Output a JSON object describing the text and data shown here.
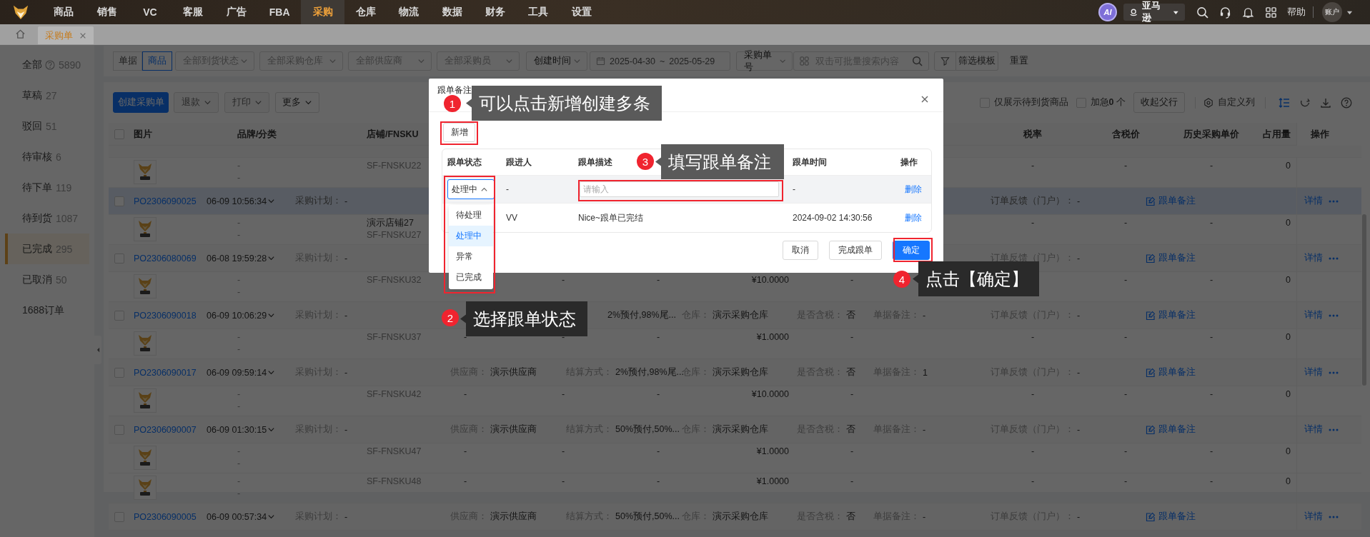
{
  "nav": {
    "items": [
      {
        "label": "商品",
        "selected": false
      },
      {
        "label": "销售",
        "selected": false
      },
      {
        "label": "VC",
        "selected": false
      },
      {
        "label": "客服",
        "selected": false
      },
      {
        "label": "广告",
        "selected": false
      },
      {
        "label": "FBA",
        "selected": false
      },
      {
        "label": "采购",
        "selected": true
      },
      {
        "label": "仓库",
        "selected": false
      },
      {
        "label": "物流",
        "selected": false
      },
      {
        "label": "数据",
        "selected": false
      },
      {
        "label": "财务",
        "selected": false
      },
      {
        "label": "工具",
        "selected": false
      },
      {
        "label": "设置",
        "selected": false
      }
    ],
    "ai": "AI",
    "marketplace": "亚马逊",
    "help": "帮助",
    "account": "账户"
  },
  "page_tabs": [
    {
      "label": "采购单",
      "selected": true,
      "closable": true
    }
  ],
  "sidebar": [
    {
      "label": "全部",
      "count": "5890",
      "info": true,
      "selected": false
    },
    {
      "label": "草稿",
      "count": "27",
      "info": false,
      "selected": false
    },
    {
      "label": "驳回",
      "count": "51",
      "info": false,
      "selected": false
    },
    {
      "label": "待审核",
      "count": "6",
      "info": false,
      "selected": false
    },
    {
      "label": "待下单",
      "count": "119",
      "info": false,
      "selected": false
    },
    {
      "label": "待到货",
      "count": "1087",
      "info": false,
      "selected": false
    },
    {
      "label": "已完成",
      "count": "295",
      "info": false,
      "selected": true
    },
    {
      "label": "已取消",
      "count": "50",
      "info": false,
      "selected": false
    },
    {
      "label": "1688订单",
      "info": false,
      "selected": false
    }
  ],
  "filters": {
    "view_toggle": [
      {
        "label": "单据",
        "selected": false
      },
      {
        "label": "商品",
        "selected": true
      }
    ],
    "selects": [
      "全部到货状态",
      "全部采购仓库",
      "全部供应商",
      "全部采购员"
    ],
    "time_type": "创建时间",
    "date_from": "2025-04-30",
    "date_sep": "~",
    "date_to": "2025-05-29",
    "search_type": "采购单号",
    "search_placeholder": "双击可批量搜索内容",
    "template": "筛选模板",
    "reset": "重置"
  },
  "toolbar": {
    "buttons": [
      {
        "label": "创建采购单",
        "kind": "primary",
        "disabled": false
      },
      {
        "label": "退款",
        "kind": "menu",
        "disabled": true
      },
      {
        "label": "打印",
        "kind": "menu",
        "disabled": true
      },
      {
        "label": "更多",
        "kind": "menu",
        "disabled": false
      }
    ],
    "only_pending": {
      "label": "仅展示待到货商品",
      "checked": false
    },
    "urgent": {
      "label": "加急**0** 个",
      "checked": false
    },
    "collapse": "收起父行",
    "custom_columns": "自定义列"
  },
  "table": {
    "all_checked": false,
    "columns": [
      "图片",
      "品牌/分类",
      "店铺/FNSKU",
      "税率",
      "含税价",
      "历史采购单价",
      "占用量",
      "操作"
    ],
    "rows": [
      {
        "kind": "item",
        "brand": "-",
        "category": "-",
        "fnsku": "SF-FNSKU22",
        "tax_rate": "-",
        "tax_price": "-",
        "history_price": "-",
        "occupied": "0"
      },
      {
        "kind": "order",
        "highlighted": true,
        "checked": false,
        "po": "PO2306090025",
        "time": "06-09 10:56:34",
        "plan": {
          "label": "采购计划：",
          "value": "-"
        },
        "feedback": {
          "label": "订单反馈（门户）：",
          "value": "-"
        },
        "note": "跟单备注",
        "detail": "详情"
      },
      {
        "kind": "item",
        "brand": "-",
        "category": "-",
        "store": "演示店铺27",
        "fnsku": "SF-FNSKU27",
        "tax_rate": "-",
        "tax_price": "-",
        "history_price": "-",
        "occupied": "0"
      },
      {
        "kind": "order",
        "highlighted": false,
        "checked": false,
        "po": "PO2306080069",
        "time": "06-08 19:59:28",
        "plan": {
          "label": "采购计划：",
          "value": "-"
        },
        "feedback": {
          "label": "订单反馈（门户）：",
          "value": "-"
        },
        "note": "跟单备注",
        "detail": "详情"
      },
      {
        "kind": "item",
        "brand": "-",
        "category": "-",
        "fnsku": "SF-FNSKU32",
        "col_5": "-",
        "col_6": "-",
        "price": "¥10.0000",
        "col_8": "-",
        "tax_price": "-",
        "history_price": "-",
        "occupied": "0"
      },
      {
        "kind": "order",
        "highlighted": false,
        "checked": false,
        "po": "PO2306090018",
        "time": "06-09 10:06:29",
        "plan": {
          "label": "采购计划：",
          "value": "-"
        },
        "settlement": {
          "value": "2%预付,98%尾..."
        },
        "warehouse": {
          "label": "仓库：",
          "value": "演示采购仓库"
        },
        "tax": {
          "label": "是否含税：",
          "value": "否"
        },
        "remark": {
          "label": "单据备注：",
          "value": "-"
        },
        "feedback": {
          "label": "订单反馈（门户）：",
          "value": "-"
        },
        "note": "跟单备注",
        "detail": "详情"
      },
      {
        "kind": "item",
        "brand": "-",
        "category": "-",
        "fnsku": "SF-FNSKU37",
        "col_4": "-",
        "col_5": "-",
        "col_6": "-",
        "price": "¥1.0000",
        "col_8": "-",
        "tax_rate": "-",
        "tax_price": "-",
        "history_price": "-",
        "occupied": "0"
      },
      {
        "kind": "order",
        "highlighted": false,
        "checked": false,
        "po": "PO2306090017",
        "time": "06-09 09:59:14",
        "plan": {
          "label": "采购计划：",
          "value": "-"
        },
        "supplier": {
          "label": "供应商：",
          "value": "演示供应商"
        },
        "settlement": {
          "label": "结算方式：",
          "value": "2%预付,98%尾..."
        },
        "warehouse": {
          "label": "仓库：",
          "value": "演示采购仓库"
        },
        "tax": {
          "label": "是否含税：",
          "value": "否"
        },
        "remark": {
          "label": "单据备注：",
          "value": "1"
        },
        "feedback": {
          "label": "订单反馈（门户）：",
          "value": "-"
        },
        "note": "跟单备注",
        "detail": "详情"
      },
      {
        "kind": "item",
        "brand": "-",
        "category": "-",
        "fnsku": "SF-FNSKU42",
        "col_4": "-",
        "col_5": "-",
        "col_6": "-",
        "price": "¥10.0000",
        "col_8": "-",
        "tax_rate": "-",
        "tax_price": "-",
        "history_price": "-",
        "occupied": "0"
      },
      {
        "kind": "order",
        "highlighted": false,
        "checked": false,
        "po": "PO2306090007",
        "time": "06-09 01:30:15",
        "plan": {
          "label": "采购计划：",
          "value": "-"
        },
        "supplier": {
          "label": "供应商：",
          "value": "演示供应商"
        },
        "settlement": {
          "label": "结算方式：",
          "value": "50%预付,50%..."
        },
        "warehouse": {
          "label": "仓库：",
          "value": "演示采购仓库"
        },
        "tax": {
          "label": "是否含税：",
          "value": "否"
        },
        "remark": {
          "label": "单据备注：",
          "value": "-"
        },
        "feedback": {
          "label": "订单反馈（门户）：",
          "value": "-"
        },
        "note": "跟单备注",
        "detail": "详情"
      },
      {
        "kind": "item",
        "brand": "-",
        "category": "-",
        "fnsku": "SF-FNSKU47",
        "col_4": "-",
        "col_5": "-",
        "col_6": "-",
        "price": "¥1.0000",
        "col_8": "-",
        "tax_rate": "-",
        "tax_price": "-",
        "history_price": "-",
        "occupied": "0"
      },
      {
        "kind": "item",
        "brand": "-",
        "category": "-",
        "fnsku": "SF-FNSKU48",
        "col_4": "-",
        "col_5": "-",
        "col_6": "-",
        "price": "¥1.0000",
        "col_8": "-",
        "tax_rate": "-",
        "tax_price": "-",
        "history_price": "-",
        "occupied": "0"
      },
      {
        "kind": "order",
        "highlighted": false,
        "checked": false,
        "po": "PO2306090005",
        "time": "06-09 00:57:34",
        "plan": {
          "label": "采购计划：",
          "value": "-"
        },
        "supplier": {
          "label": "供应商：",
          "value": "演示供应商"
        },
        "settlement": {
          "label": "结算方式：",
          "value": "50%预付,50%..."
        },
        "warehouse": {
          "label": "仓库：",
          "value": "演示采购仓库"
        },
        "tax": {
          "label": "是否含税：",
          "value": "否"
        },
        "remark": {
          "label": "单据备注：",
          "value": "-"
        },
        "feedback": {
          "label": "订单反馈（门户）：",
          "value": "-"
        },
        "note": "跟单备注",
        "detail": "详情"
      }
    ]
  },
  "dialog": {
    "title": "跟单备注",
    "add": "新增",
    "columns": [
      "跟单状态",
      "跟进人",
      "跟单描述",
      "跟单时间",
      "操作"
    ],
    "rows": [
      {
        "status": "处理中",
        "follower": "-",
        "description_placeholder": "请输入",
        "time": "-",
        "action": "删除"
      },
      {
        "follower": "VV",
        "description": "Nice~跟单已完结",
        "time": "2024-09-02 14:30:56",
        "action": "删除"
      }
    ],
    "status_dropdown": {
      "open": true,
      "options": [
        {
          "label": "待处理",
          "selected": false
        },
        {
          "label": "处理中",
          "selected": true
        },
        {
          "label": "异常",
          "selected": false
        },
        {
          "label": "已完成",
          "selected": false
        }
      ]
    },
    "buttons": [
      {
        "label": "取消",
        "kind": "default"
      },
      {
        "label": "完成跟单",
        "kind": "default"
      },
      {
        "label": "确定",
        "kind": "primary"
      }
    ]
  },
  "annotations": [
    {
      "number": "1",
      "text": "可以点击新增创建多条",
      "color": "#5a5a5a"
    },
    {
      "number": "2",
      "text": "选择跟单状态",
      "color": "#2a2a2a"
    },
    {
      "number": "3",
      "text": "填写跟单备注",
      "color": "#5a5a5a"
    },
    {
      "number": "4",
      "text": "点击【确定】",
      "color": "#2a2a2a"
    }
  ]
}
